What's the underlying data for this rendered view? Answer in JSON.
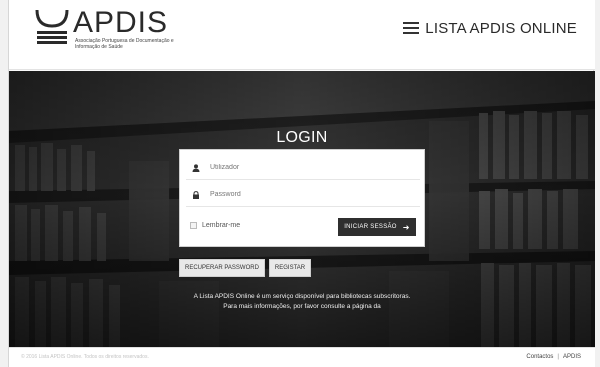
{
  "header": {
    "logo_text": "APDIS",
    "logo_subtitle": "Associação Portuguesa de Documentação e Informação de Saúde",
    "menu_label": "LISTA APDIS ONLINE"
  },
  "login": {
    "title": "LOGIN",
    "username_placeholder": "Utilizador",
    "password_placeholder": "Password",
    "remember_label": "Lembrar-me",
    "submit_label": "INICIAR SESSÃO",
    "submit_icon": "arrow-right",
    "recover_label": "RECUPERAR PASSWORD",
    "register_label": "REGISTAR"
  },
  "info": {
    "line1": "A Lista APDIS Online é um serviço disponível para bibliotecas subscritoras.",
    "line2": "Para mais informações, por favor consulte a página da"
  },
  "footer": {
    "left_text": "© 2016 Lista APDIS Online. Todos os direitos reservados.",
    "links": [
      "Contactos",
      "APDIS"
    ]
  },
  "colors": {
    "button_dark": "#2f2f2f",
    "text_dark": "#2a2a2a",
    "background_dim": "#333333"
  }
}
